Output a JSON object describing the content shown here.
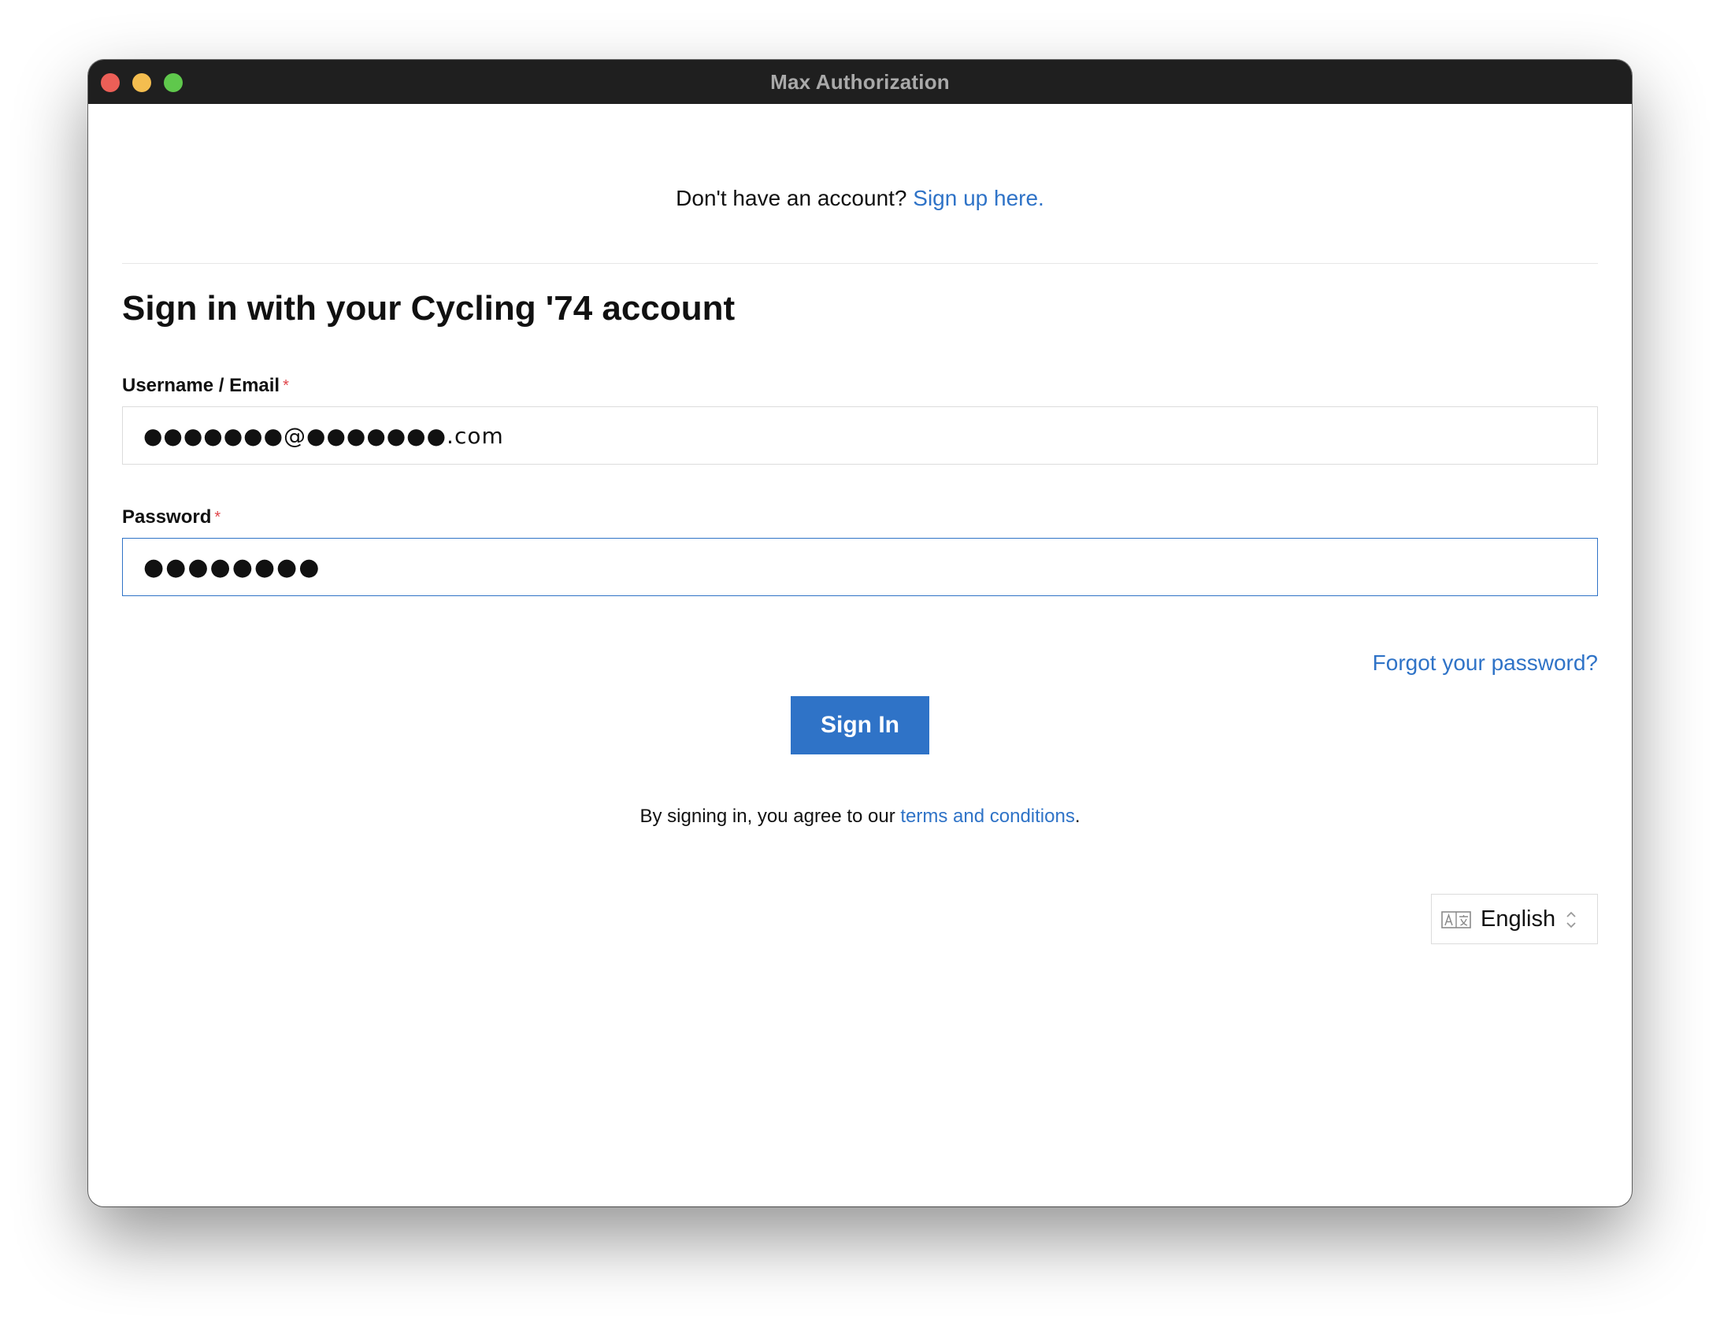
{
  "window": {
    "title": "Max Authorization"
  },
  "signup": {
    "prompt": "Don't have an account? ",
    "link_label": "Sign up here."
  },
  "heading": "Sign in with your Cycling '74 account",
  "username": {
    "label": "Username / Email",
    "required_mark": "*",
    "value": "●●●●●●●@●●●●●●●.com"
  },
  "password": {
    "label": "Password",
    "required_mark": "*",
    "value": "●●●●●●●●"
  },
  "forgot_password_label": "Forgot your password?",
  "signin_button_label": "Sign In",
  "terms": {
    "prefix": "By signing in, you agree to our ",
    "link_label": "terms and conditions",
    "suffix": "."
  },
  "language": {
    "icon": "translate-icon",
    "selected": "English"
  },
  "colors": {
    "accent": "#2f73c7",
    "required": "#e0454a",
    "titlebar": "#1f1f1f"
  }
}
